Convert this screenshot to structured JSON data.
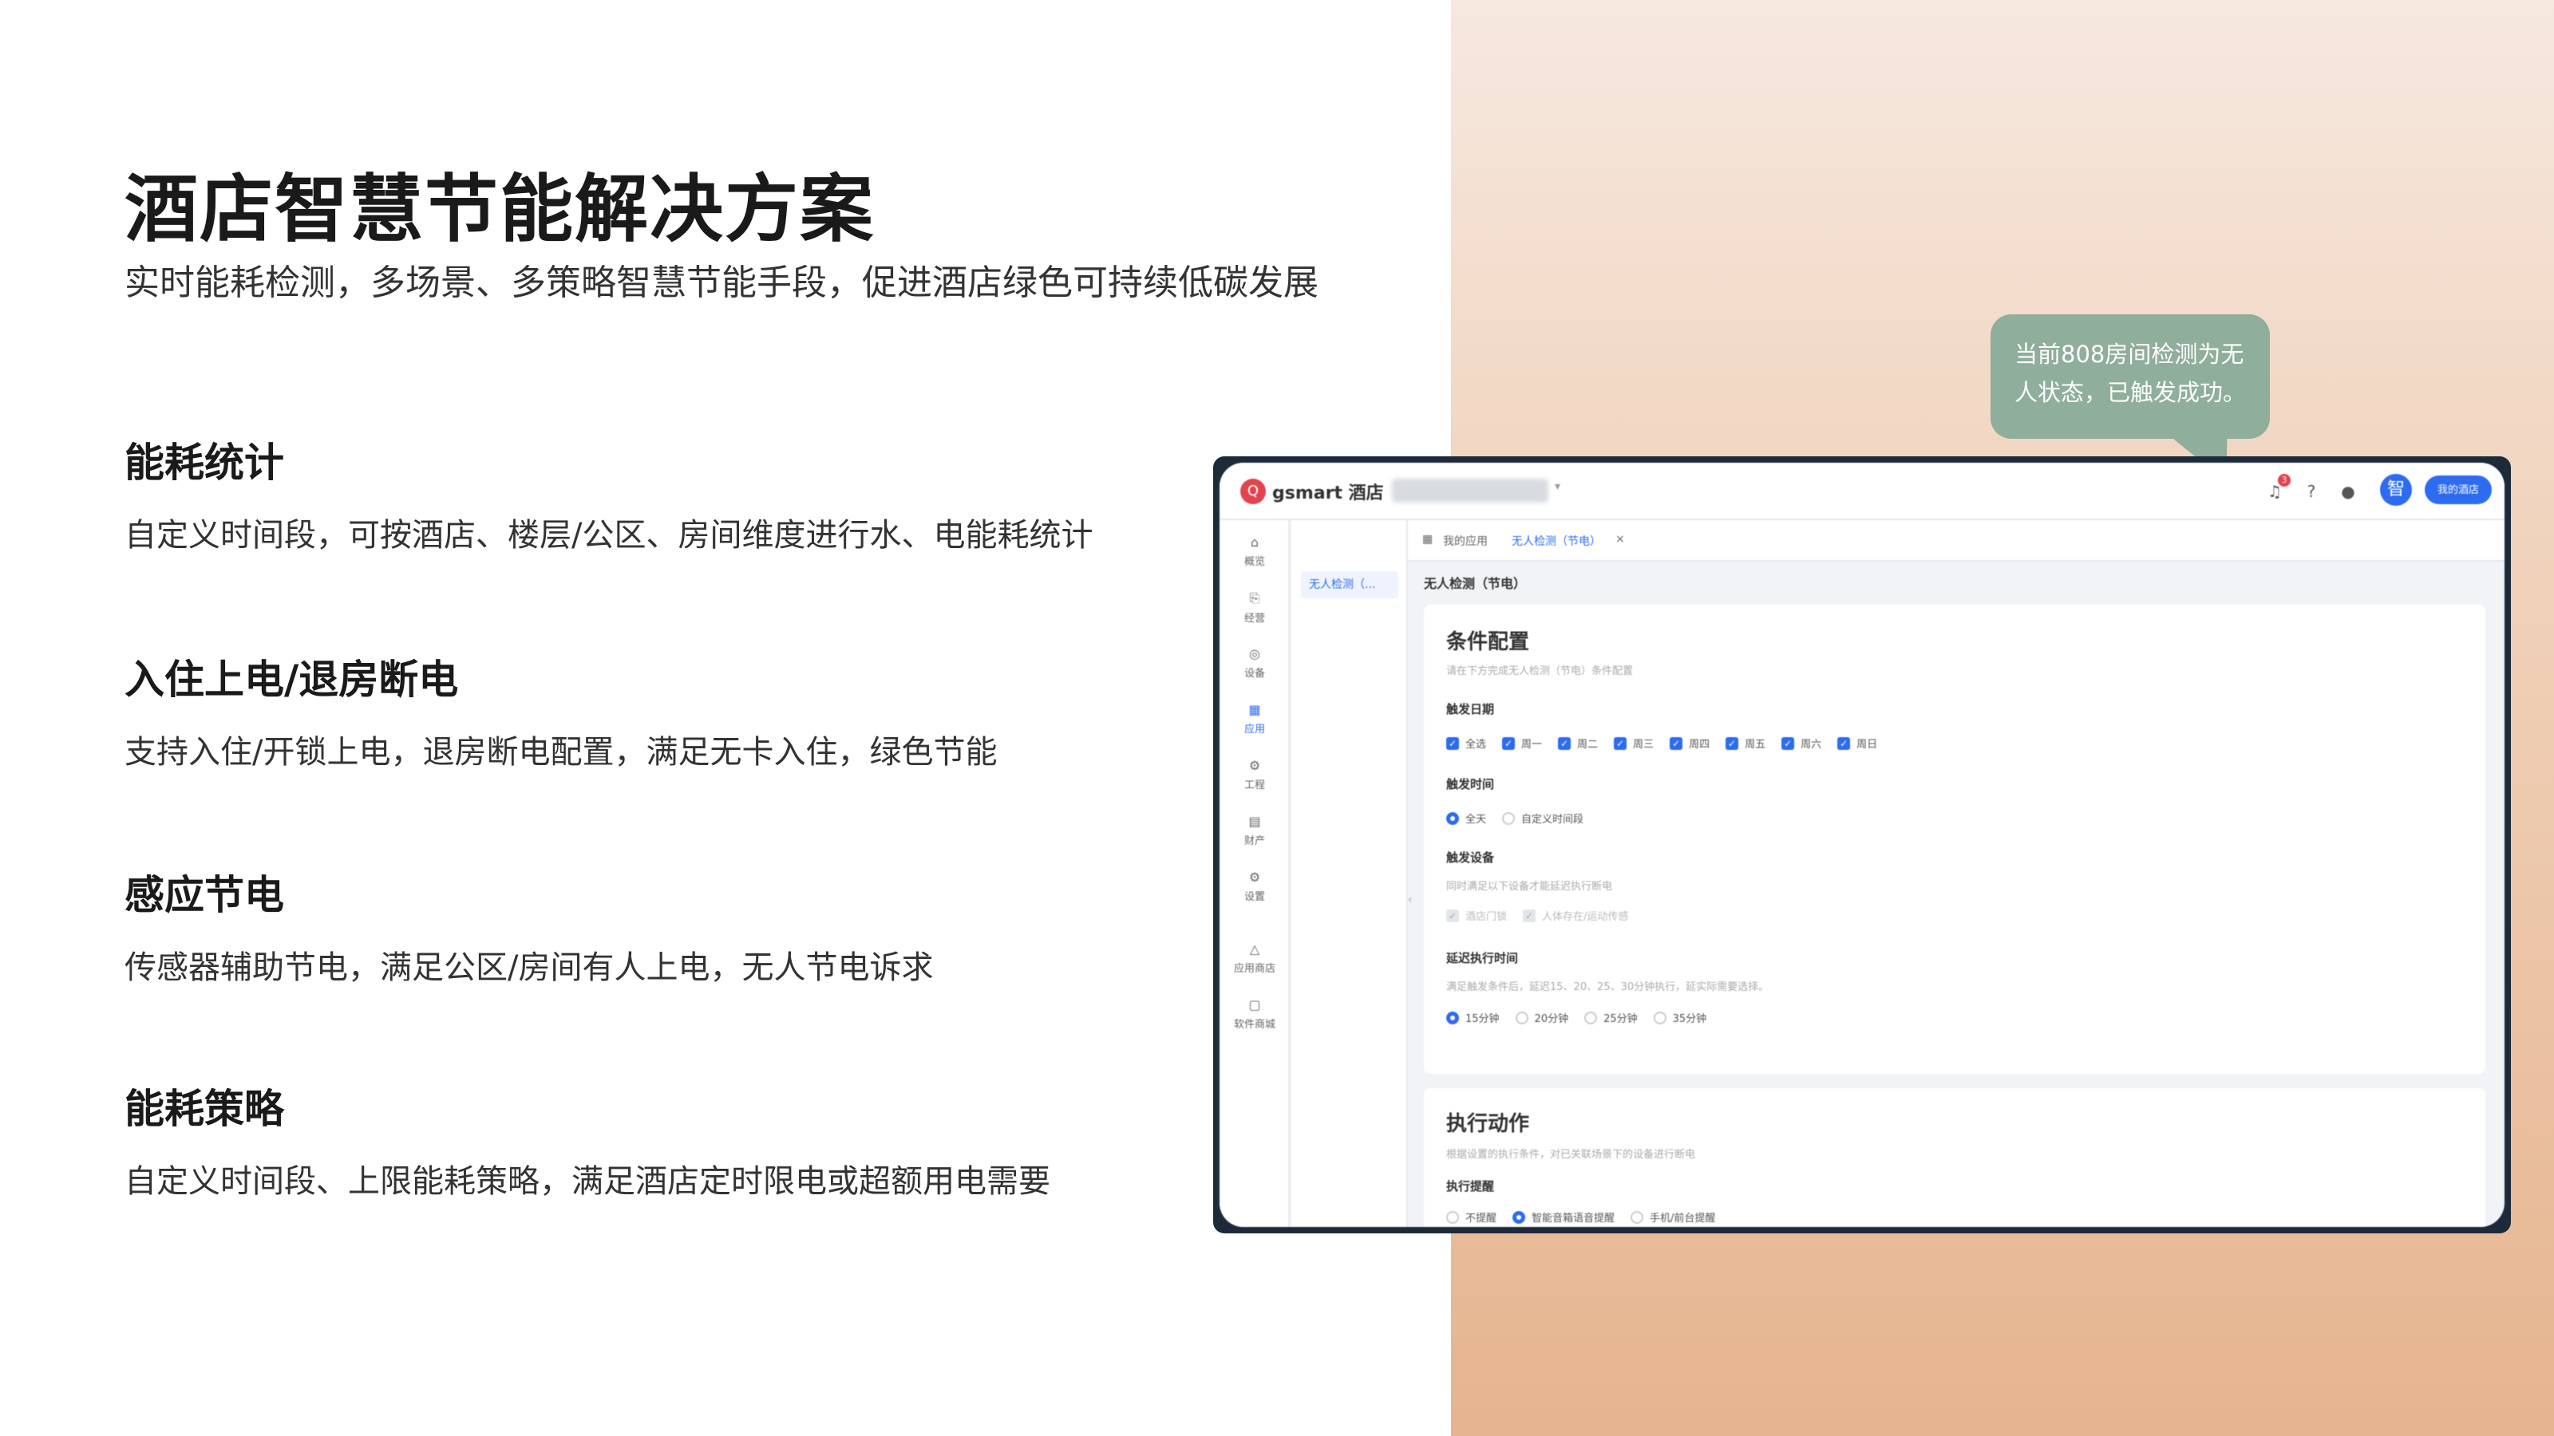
{
  "slide": {
    "title": "酒店智慧节能解决方案",
    "subtitle": "实时能耗检测，多场景、多策略智慧节能手段，促进酒店绿色可持续低碳发展",
    "features": [
      {
        "heading": "能耗统计",
        "text": "自定义时间段，可按酒店、楼层/公区、房间维度进行水、电能耗统计"
      },
      {
        "heading": "入住上电/退房断电",
        "text": "支持入住/开锁上电，退房断电配置，满足无卡入住，绿色节能"
      },
      {
        "heading": "感应节电",
        "text": "传感器辅助节电，满足公区/房间有人上电，无人节电诉求"
      },
      {
        "heading": "能耗策略",
        "text": "自定义时间段、上限能耗策略，满足酒店定时限电或超额用电需要"
      }
    ],
    "bubble_text": "当前808房间检测为无人状态，已触发成功。"
  },
  "app": {
    "logo_text": "gsmart 酒店",
    "logo_glyph": "Q",
    "topbar": {
      "notification_count": "3",
      "avatar_text": "智",
      "primary_button": "我的酒店"
    },
    "sidebar": [
      {
        "icon": "⌂",
        "label": "概览"
      },
      {
        "icon": "⎘",
        "label": "经营"
      },
      {
        "icon": "◎",
        "label": "设备"
      },
      {
        "icon": "▦",
        "label": "应用"
      },
      {
        "icon": "⚙",
        "label": "工程"
      },
      {
        "icon": "▤",
        "label": "财产"
      },
      {
        "icon": "⚙",
        "label": "设置"
      },
      {
        "icon": "△",
        "label": "应用商店"
      },
      {
        "icon": "▢",
        "label": "软件商城"
      }
    ],
    "subnav_item": "无人检测（...",
    "tabs": {
      "my_apps": "我的应用",
      "current": "无人检测（节电）",
      "close": "×"
    },
    "page_title": "无人检测（节电）",
    "condition_card": {
      "title": "条件配置",
      "desc": "请在下方完成无人检测（节电）条件配置",
      "trigger_date_label": "触发日期",
      "days": [
        "全选",
        "周一",
        "周二",
        "周三",
        "周四",
        "周五",
        "周六",
        "周日"
      ],
      "trigger_time_label": "触发时间",
      "time_options": [
        "全天",
        "自定义时间段"
      ],
      "trigger_device_label": "触发设备",
      "trigger_device_desc": "同时满足以下设备才能延迟执行断电",
      "device_options": [
        "酒店门锁",
        "人体存在/运动传感"
      ],
      "delay_label": "延迟执行时间",
      "delay_desc": "满足触发条件后，延迟15、20、25、30分钟执行，延实际需要选择。",
      "delay_options": [
        "15分钟",
        "20分钟",
        "25分钟",
        "35分钟"
      ]
    },
    "action_card": {
      "title": "执行动作",
      "desc": "根据设置的执行条件，对已关联场景下的设备进行断电",
      "remind_label": "执行提醒",
      "remind_options": [
        "不提醒",
        "智能音箱语音提醒",
        "手机/前台提醒"
      ]
    }
  }
}
